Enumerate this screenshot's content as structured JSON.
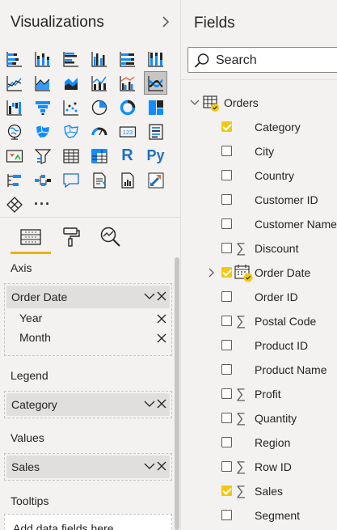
{
  "visualizations": {
    "title": "Visualizations",
    "icon_rows": [
      [
        "stacked-bar-chart-icon",
        "stacked-column-chart-icon",
        "clustered-bar-chart-icon",
        "clustered-column-chart-icon",
        "100-stacked-bar-chart-icon",
        "100-stacked-column-chart-icon"
      ],
      [
        "line-chart-icon",
        "area-chart-icon",
        "stacked-area-chart-icon",
        "line-and-stacked-column-chart-icon",
        "line-and-clustered-column-chart-icon",
        "ribbon-chart-icon"
      ],
      [
        "waterfall-chart-icon",
        "funnel-icon",
        "scatter-chart-icon",
        "pie-chart-icon",
        "donut-chart-icon",
        "treemap-icon"
      ],
      [
        "map-icon",
        "filled-map-icon",
        "shape-map-icon",
        "gauge-icon",
        "card-icon",
        "multi-row-card-icon"
      ],
      [
        "kpi-icon",
        "slicer-icon",
        "table-icon",
        "matrix-icon",
        "r-visual-icon",
        "python-visual-icon"
      ],
      [
        "key-influencers-icon",
        "decomposition-tree-icon",
        "qa-icon",
        "smart-narrative-icon",
        "paginated-report-icon",
        "power-apps-icon"
      ],
      [
        "power-automate-icon",
        "more-visuals-icon"
      ]
    ],
    "selected_icon": "ribbon-chart-icon",
    "r_label": "R",
    "py_label": "Py",
    "more_label": "···",
    "tabs": [
      "fields-tab",
      "format-tab",
      "analytics-tab"
    ],
    "active_tab": "fields-tab",
    "accent_color": "#e8b300"
  },
  "wells": {
    "axis": {
      "label": "Axis",
      "field": "Order Date",
      "sub_fields": [
        "Year",
        "Month"
      ]
    },
    "legend": {
      "label": "Legend",
      "field": "Category"
    },
    "values": {
      "label": "Values",
      "field": "Sales"
    },
    "tooltips": {
      "label": "Tooltips",
      "placeholder": "Add data fields here"
    }
  },
  "fields": {
    "title": "Fields",
    "search_placeholder": "Search",
    "table": {
      "name": "Orders",
      "expanded": true
    },
    "items": [
      {
        "name": "Category",
        "checked": true,
        "sigma": false
      },
      {
        "name": "City",
        "checked": false,
        "sigma": false
      },
      {
        "name": "Country",
        "checked": false,
        "sigma": false
      },
      {
        "name": "Customer ID",
        "checked": false,
        "sigma": false
      },
      {
        "name": "Customer Name",
        "checked": false,
        "sigma": false
      },
      {
        "name": "Discount",
        "checked": false,
        "sigma": true
      },
      {
        "name": "Order Date",
        "checked": true,
        "sigma": false,
        "hierarchy": true
      },
      {
        "name": "Order ID",
        "checked": false,
        "sigma": false
      },
      {
        "name": "Postal Code",
        "checked": false,
        "sigma": true
      },
      {
        "name": "Product ID",
        "checked": false,
        "sigma": false
      },
      {
        "name": "Product Name",
        "checked": false,
        "sigma": false
      },
      {
        "name": "Profit",
        "checked": false,
        "sigma": true
      },
      {
        "name": "Quantity",
        "checked": false,
        "sigma": true
      },
      {
        "name": "Region",
        "checked": false,
        "sigma": false
      },
      {
        "name": "Row ID",
        "checked": false,
        "sigma": true
      },
      {
        "name": "Sales",
        "checked": true,
        "sigma": true
      },
      {
        "name": "Segment",
        "checked": false,
        "sigma": false
      }
    ],
    "check_color": "#f2c811"
  }
}
